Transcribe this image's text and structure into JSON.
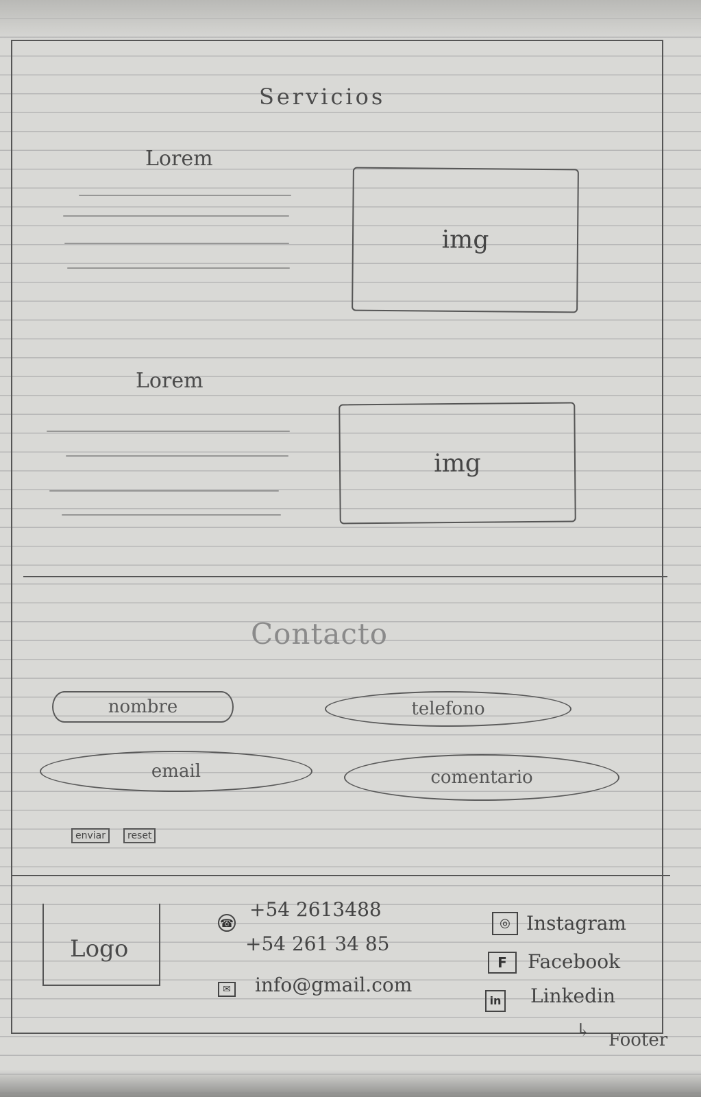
{
  "services": {
    "title": "Servicios",
    "items": [
      {
        "heading": "Lorem",
        "image_label": "img"
      },
      {
        "heading": "Lorem",
        "image_label": "img"
      }
    ]
  },
  "contact": {
    "title": "Contacto",
    "fields": {
      "name": "nombre",
      "phone": "telefono",
      "email": "email",
      "comment": "comentario"
    },
    "buttons": {
      "send": "enviar",
      "reset": "reset"
    }
  },
  "footer": {
    "logo": "Logo",
    "phones": [
      "+54 2613488",
      "+54 261 34 85"
    ],
    "email": "info@gmail.com",
    "social": [
      "Instagram",
      "Facebook",
      "Linkedin"
    ],
    "annotation": "Footer"
  },
  "colors": {
    "paper": "#d9d9d6",
    "pencil": "#4a4a4a"
  }
}
